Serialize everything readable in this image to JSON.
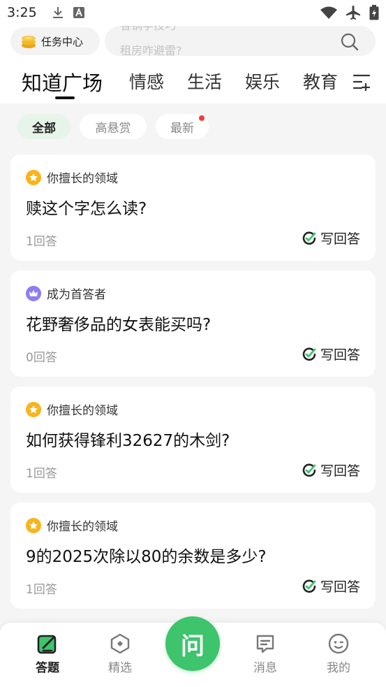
{
  "status_bar": {
    "time": "3:25"
  },
  "header": {
    "task_center_label": "任务中心",
    "search": {
      "hint_top": "香锅学技巧",
      "hint_bottom": "租房咋避雷?"
    },
    "tabs": [
      {
        "label": "知道广场",
        "active": true
      },
      {
        "label": "情感",
        "active": false
      },
      {
        "label": "生活",
        "active": false
      },
      {
        "label": "娱乐",
        "active": false
      },
      {
        "label": "教育",
        "active": false
      }
    ]
  },
  "filters": [
    {
      "label": "全部",
      "active": true
    },
    {
      "label": "高悬赏",
      "active": false
    },
    {
      "label": "最新",
      "active": false,
      "dot": true
    }
  ],
  "questions": [
    {
      "tag": "你擅长的领域",
      "tag_icon": "star-icon",
      "title": "赎这个字怎么读?",
      "answers": "1回答",
      "action": "写回答"
    },
    {
      "tag": "成为首答者",
      "tag_icon": "crown-icon",
      "title": "花野奢侈品的女表能买吗?",
      "answers": "0回答",
      "action": "写回答"
    },
    {
      "tag": "你擅长的领域",
      "tag_icon": "star-icon",
      "title": "如何获得锋利32627的木剑?",
      "answers": "1回答",
      "action": "写回答"
    },
    {
      "tag": "你擅长的领域",
      "tag_icon": "star-icon",
      "title": "9的2025次除以80的余数是多少?",
      "answers": "1回答",
      "action": "写回答"
    }
  ],
  "bottom_nav": {
    "items": [
      {
        "label": "答题",
        "icon": "answer-icon",
        "active": true
      },
      {
        "label": "精选",
        "icon": "featured-icon",
        "active": false
      },
      {
        "label": "消息",
        "icon": "message-icon",
        "active": false
      },
      {
        "label": "我的",
        "icon": "profile-icon",
        "active": false
      }
    ],
    "ask_label": "问"
  },
  "colors": {
    "brand_green": "#3ec46c",
    "star_yellow": "#f6b51e",
    "crown_purple": "#8f7cf0",
    "dot_red": "#f03c3c"
  }
}
